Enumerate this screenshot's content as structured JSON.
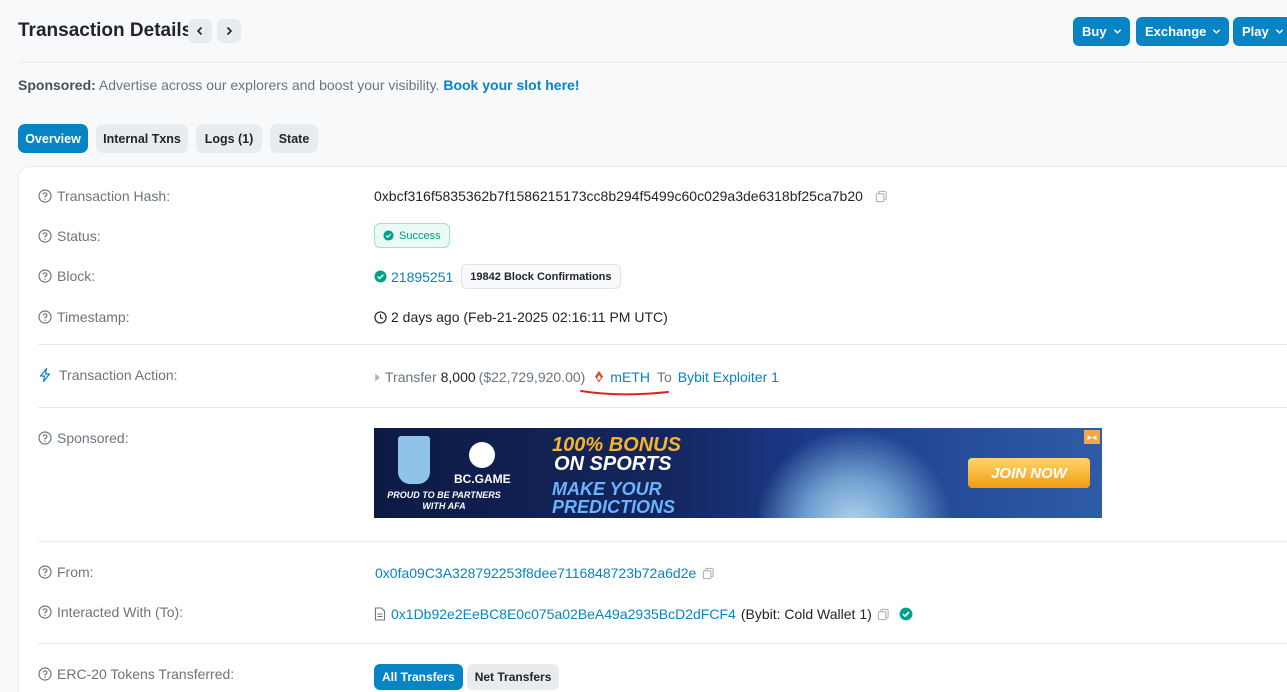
{
  "header": {
    "title": "Transaction Details",
    "buttons": {
      "buy": "Buy",
      "exchange": "Exchange",
      "play": "Play"
    }
  },
  "sponsored_line": {
    "prefix": "Sponsored:",
    "text": " Advertise across our explorers and boost your visibility. ",
    "link": "Book your slot here!"
  },
  "tabs": [
    {
      "label": "Overview",
      "active": true
    },
    {
      "label": "Internal Txns",
      "active": false
    },
    {
      "label": "Logs (1)",
      "active": false
    },
    {
      "label": "State",
      "active": false
    }
  ],
  "details": {
    "hash": {
      "label": "Transaction Hash:",
      "value": "0xbcf316f5835362b7f1586215173cc8b294f5499c60c029a3de6318bf25ca7b20"
    },
    "status": {
      "label": "Status:",
      "value": "Success"
    },
    "block": {
      "label": "Block:",
      "number": "21895251",
      "confirmations": "19842 Block Confirmations"
    },
    "timestamp": {
      "label": "Timestamp:",
      "value": "2 days ago (Feb-21-2025 02:16:11 PM UTC)"
    },
    "action": {
      "label": "Transaction Action:",
      "verb": "Transfer",
      "amount": "8,000",
      "usd": "($22,729,920.00)",
      "token": "mETH",
      "to_word": "To",
      "recipient": "Bybit Exploiter 1"
    },
    "sponsored": {
      "label": "Sponsored:",
      "ad": {
        "brand": "BC.GAME",
        "partners": "PROUD TO BE PARTNERS WITH AFA",
        "headline1": "100% BONUS",
        "headline2": "ON SPORTS",
        "headline3": "MAKE YOUR",
        "headline4": "PREDICTIONS",
        "cta": "JOIN NOW"
      }
    },
    "from": {
      "label": "From:",
      "value": "0x0fa09C3A328792253f8dee7116848723b72a6d2e"
    },
    "to": {
      "label": "Interacted With (To):",
      "value": "0x1Db92e2EeBC8E0c075a02BeA49a2935BcD2dFCF4",
      "name": "(Bybit: Cold Wallet 1)"
    },
    "erc20": {
      "label": "ERC-20 Tokens Transferred:",
      "all": "All Transfers",
      "net": "Net Transfers"
    }
  },
  "colors": {
    "accent": "#0784c3",
    "success": "#00a186",
    "annotation": "#d9261c"
  }
}
